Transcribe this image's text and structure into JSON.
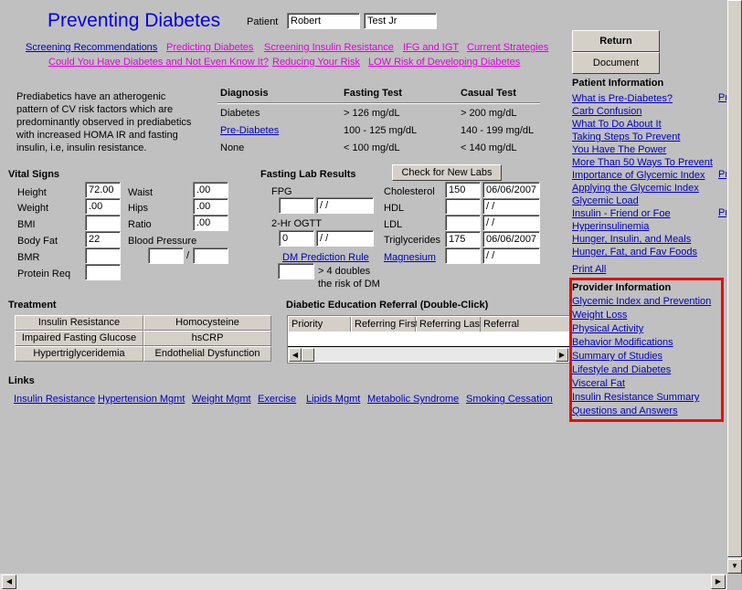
{
  "title": "Preventing Diabetes",
  "patient": {
    "label": "Patient",
    "first": "Robert",
    "last": "Test Jr"
  },
  "top_links": [
    {
      "label": "Screening Recommendations",
      "color": "blue"
    },
    {
      "label": "Predicting Diabetes",
      "color": "magenta"
    },
    {
      "label": "Screening Insulin Resistance",
      "color": "magenta"
    },
    {
      "label": "IFG and IGT",
      "color": "magenta"
    },
    {
      "label": "Current Strategies",
      "color": "magenta"
    },
    {
      "label": "Could You Have Diabetes and Not Even Know It?",
      "color": "magenta"
    },
    {
      "label": "Reducing Your Risk",
      "color": "magenta"
    },
    {
      "label": "LOW Risk of Developing Diabetes",
      "color": "magenta"
    }
  ],
  "intro": [
    "Prediabetics  have an atherogenic",
    "pattern of CV risk factors which are",
    "predominantly observed in prediabetics",
    "with increased HOMA IR and fasting",
    "insulin, i.e, insulin resistance."
  ],
  "diagnosis_table": {
    "headers": [
      "Diagnosis",
      "Fasting Test",
      "Casual Test"
    ],
    "rows": [
      [
        "Diabetes",
        "> 126 mg/dL",
        "> 200 mg/dL"
      ],
      [
        "Pre-Diabetes",
        "100 - 125 mg/dL",
        "140 - 199 mg/dL"
      ],
      [
        "None",
        "< 100 mg/dL",
        "< 140 mg/dL"
      ]
    ]
  },
  "vitals": {
    "title": "Vital Signs",
    "height": {
      "label": "Height",
      "value": "72.00"
    },
    "weight": {
      "label": "Weight",
      "value": ".00"
    },
    "bmi": {
      "label": "BMI",
      "value": ""
    },
    "body_fat": {
      "label": "Body Fat",
      "value": "22"
    },
    "bmr": {
      "label": "BMR",
      "value": ""
    },
    "protein": {
      "label": "Protein Req",
      "value": ""
    },
    "waist": {
      "label": "Waist",
      "value": ".00"
    },
    "hips": {
      "label": "Hips",
      "value": ".00"
    },
    "ratio": {
      "label": "Ratio",
      "value": ".00"
    },
    "bp": {
      "label": "Blood Pressure",
      "sys": "",
      "dia": "",
      "sep": "/"
    }
  },
  "labs": {
    "title": "Fasting Lab Results",
    "check_button": "Check for New Labs",
    "fpg": {
      "label": "FPG",
      "value": "",
      "date": " / /"
    },
    "ogtt": {
      "label": "2-Hr OGTT",
      "value": "0",
      "date": " / /"
    },
    "dm_rule": "DM Prediction Rule",
    "dm_value": "",
    "dm_note1": "> 4 doubles",
    "dm_note2": "the risk of DM",
    "cholesterol": {
      "label": "Cholesterol",
      "value": "150",
      "date": "06/06/2007"
    },
    "hdl": {
      "label": "HDL",
      "value": "",
      "date": " / /"
    },
    "ldl": {
      "label": "LDL",
      "value": "",
      "date": " / /"
    },
    "trig": {
      "label": "Triglycerides",
      "value": "175",
      "date": "06/06/2007"
    },
    "magnesium": {
      "label": "Magnesium",
      "value": "",
      "date": " / /"
    }
  },
  "treatment": {
    "title": "Treatment",
    "buttons": [
      "Insulin Resistance",
      "Homocysteine",
      "Impaired Fasting Glucose",
      "hsCRP",
      "Hypertriglyceridemia",
      "Endothelial Dysfunction"
    ]
  },
  "referral": {
    "title": "Diabetic Education Referral (Double-Click)",
    "columns": [
      "Priority",
      "Referring First",
      "Referring Last",
      "Referral"
    ]
  },
  "links": {
    "title": "Links",
    "items": [
      "Insulin Resistance",
      "Hypertension Mgmt",
      "Weight Mgmt",
      "Exercise",
      "Lipids Mgmt",
      "Metabolic Syndrome",
      "Smoking Cessation"
    ]
  },
  "sidebar": {
    "return": "Return",
    "document": "Document",
    "patient_title": "Patient Information",
    "patient_items": [
      "What is Pre-Diabetes?",
      "Carb Confusion",
      "What To Do About It",
      "Taking Steps To Prevent",
      "You Have The Power",
      "More Than 50 Ways To Prevent",
      "Importance of Glycemic Index",
      "Applying the Glycemic Index",
      "Glycemic Load",
      "Insulin - Friend or Foe",
      "Hyperinsulinemia",
      "Hunger, Insulin, and Meals",
      "Hunger, Fat, and Fav Foods"
    ],
    "truncated": "Pr",
    "print_all": "Print All",
    "provider_title": "Provider Information",
    "provider_items": [
      "Glycemic Index and Prevention",
      "Weight Loss",
      "Physical Activity",
      "Behavior Modifications",
      "Summary of Studies",
      "Lifestyle and Diabetes",
      "Visceral Fat",
      "Insulin Resistance Summary",
      "Questions and Answers"
    ],
    "highlight_color": "#e01010"
  },
  "colors": {
    "background": "#c0c0c0",
    "link": "#0000c0",
    "magenta_link": "#e000e0",
    "title": "#0000e0"
  }
}
